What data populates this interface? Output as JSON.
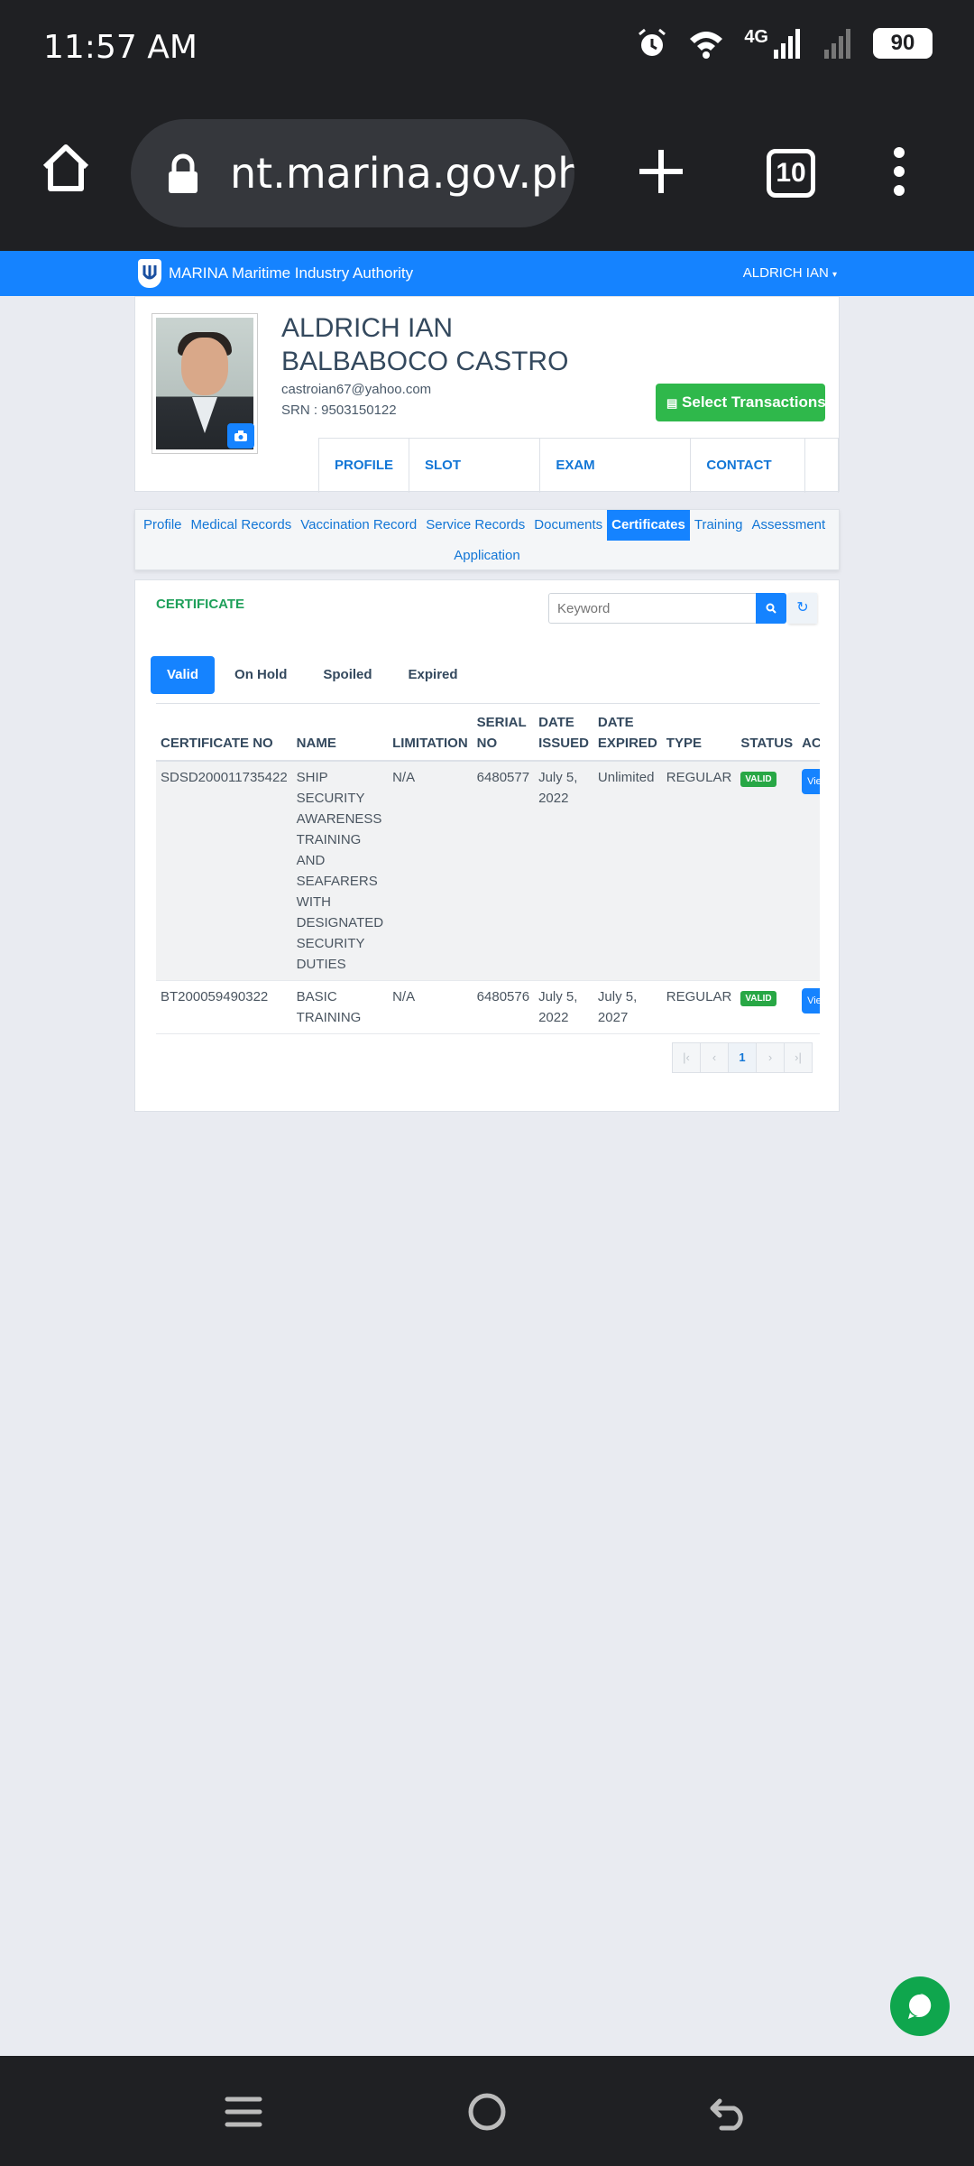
{
  "status_bar": {
    "time": "11:57 AM",
    "network": "4G",
    "battery": "90"
  },
  "browser": {
    "url": "nt.marina.gov.ph",
    "tab_count": "10"
  },
  "navbar": {
    "brand": "MARINA Maritime Industry Authority",
    "user_menu": "ALDRICH IAN"
  },
  "profile": {
    "name_line1": "ALDRICH IAN",
    "name_line2": "BALBABOCO CASTRO",
    "email": "castroian67@yahoo.com",
    "srn": "SRN : 9503150122",
    "select_transaction_label": "Select Transactions",
    "tabs": [
      "PROFILE",
      "SLOT LOCATOR",
      "EXAM SCHEDULES",
      "CONTACT US"
    ]
  },
  "subnav": {
    "items": [
      "Profile",
      "Medical Records",
      "Vaccination Record",
      "Service Records",
      "Documents",
      "Certificates",
      "Training",
      "Assessment"
    ],
    "row2": "Application",
    "active": "Certificates"
  },
  "certificate": {
    "title": "CERTIFICATE",
    "search_placeholder": "Keyword",
    "status_tabs": [
      "Valid",
      "On Hold",
      "Spoiled",
      "Expired"
    ],
    "active_tab": "Valid",
    "columns": {
      "cert_no": "CERTIFICATE NO",
      "name": "NAME",
      "limitation": "LIMITATION",
      "serial_no": "SERIAL NO",
      "date_issued": "DATE ISSUED",
      "date_expired": "DATE EXPIRED",
      "type": "TYPE",
      "status": "STATUS",
      "action": "ACTION"
    },
    "rows": [
      {
        "cert_no": "SDSD200011735422",
        "name": "SHIP SECURITY AWARENESS TRAINING AND SEAFARERS WITH DESIGNATED SECURITY DUTIES",
        "limitation": "N/A",
        "serial_no": "6480577",
        "date_issued": "July 5, 2022",
        "date_expired": "Unlimited",
        "type": "REGULAR",
        "status": "VALID",
        "action": "View"
      },
      {
        "cert_no": "BT200059490322",
        "name": "BASIC TRAINING",
        "limitation": "N/A",
        "serial_no": "6480576",
        "date_issued": "July 5, 2022",
        "date_expired": "July 5, 2027",
        "type": "REGULAR",
        "status": "VALID",
        "action": "View"
      }
    ],
    "pagination": {
      "first": "|‹",
      "prev": "‹",
      "current": "1",
      "next": "›",
      "last": "›|"
    }
  },
  "colors": {
    "primary": "#1583ff",
    "success": "#28a745",
    "chrome": "#1f2023"
  }
}
